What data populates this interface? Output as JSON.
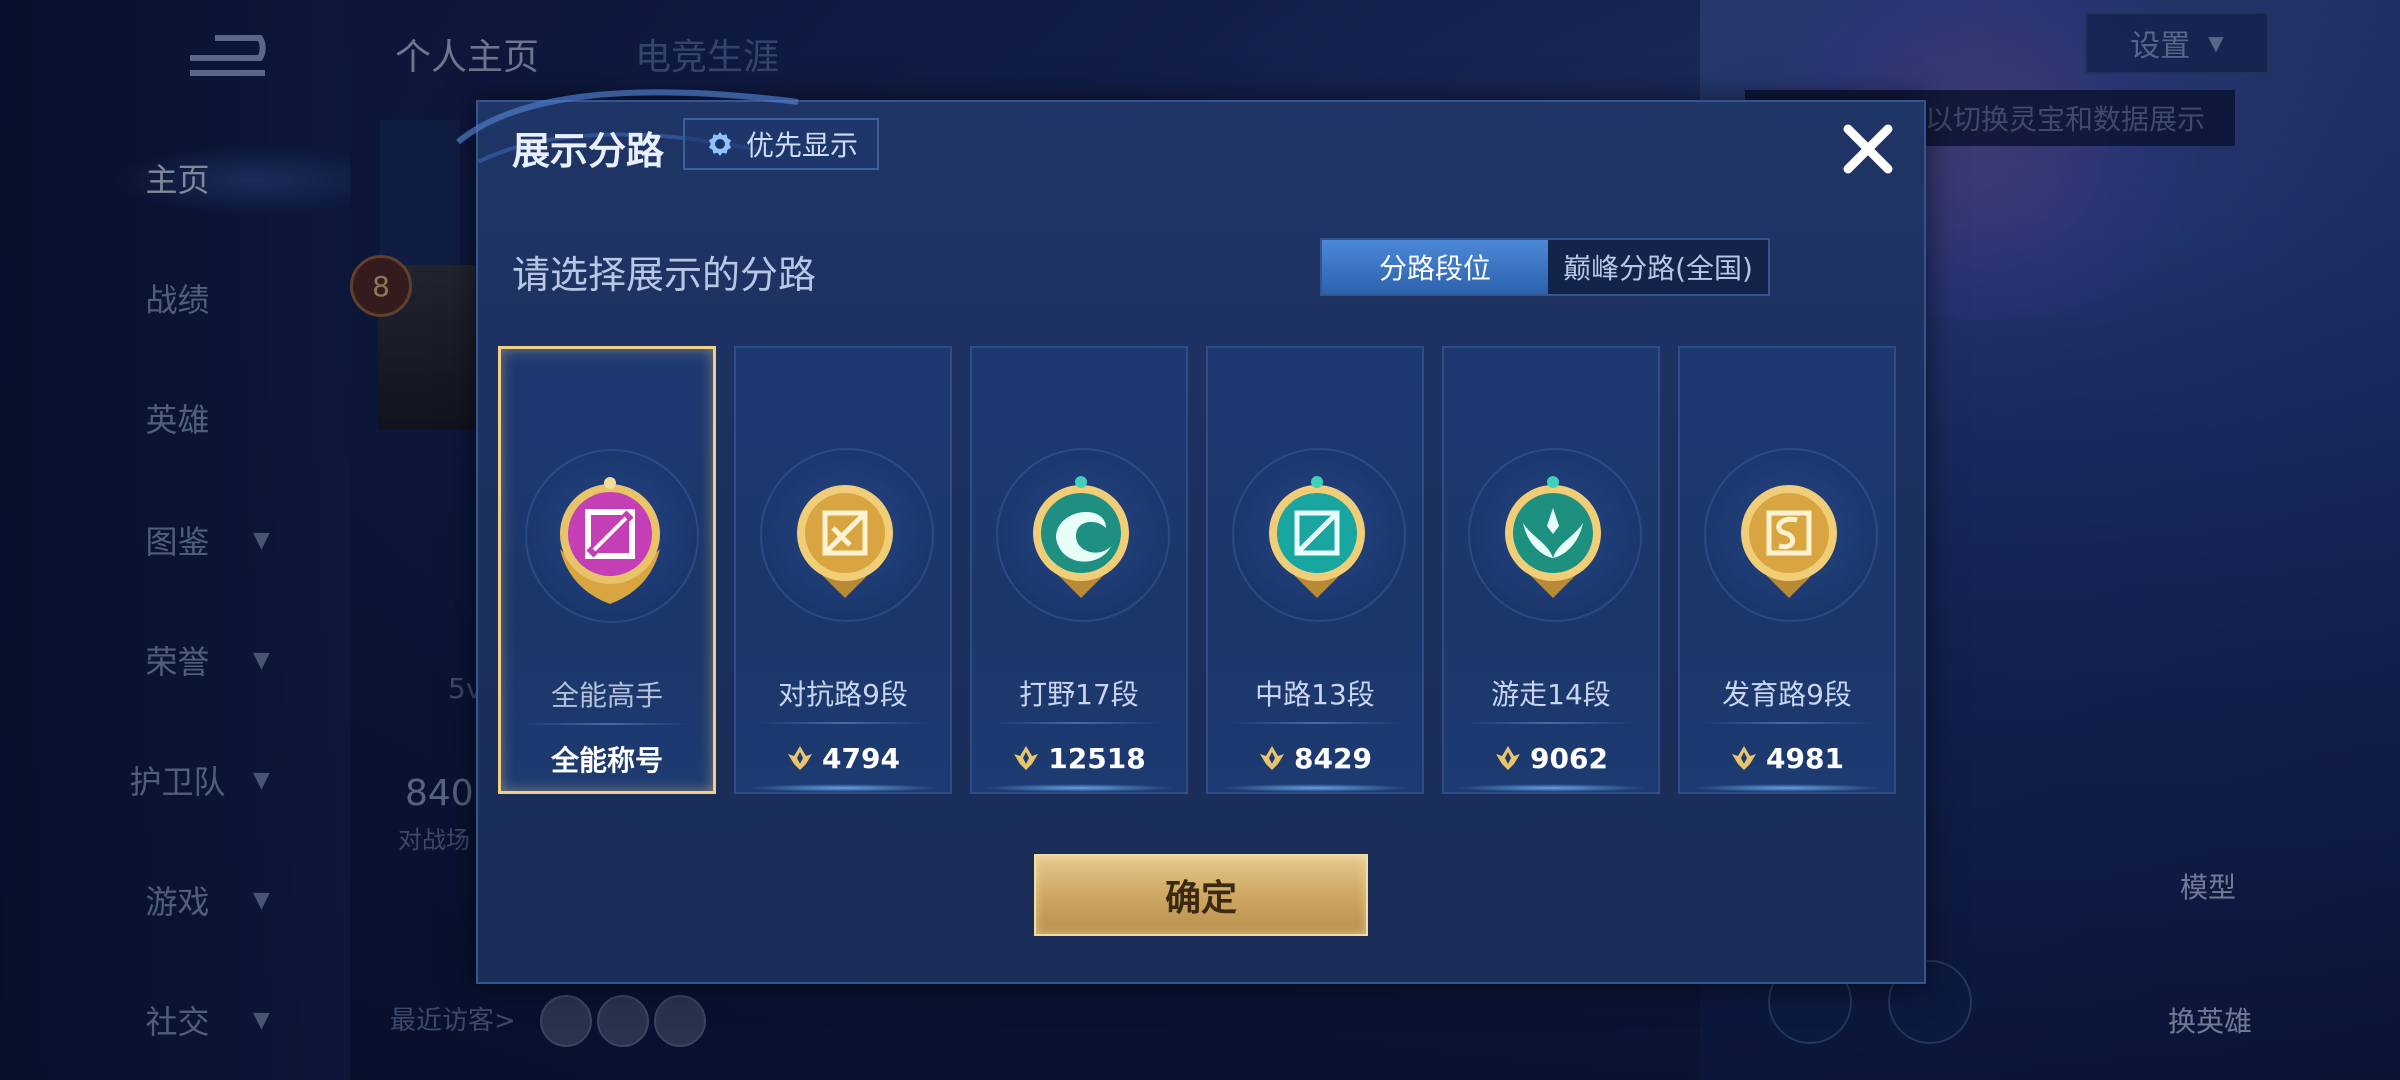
{
  "background": {
    "tabs": [
      "个人主页",
      "电竞生涯"
    ],
    "nav": [
      {
        "label": "主页",
        "has_chevron": false
      },
      {
        "label": "战绩",
        "has_chevron": false
      },
      {
        "label": "英雄",
        "has_chevron": false
      },
      {
        "label": "图鉴",
        "has_chevron": true
      },
      {
        "label": "荣誉",
        "has_chevron": true
      },
      {
        "label": "护卫队",
        "has_chevron": true
      },
      {
        "label": "游戏",
        "has_chevron": true
      },
      {
        "label": "社交",
        "has_chevron": true
      }
    ],
    "settings_label": "设置",
    "tip_text": "以切换灵宝和数据展示",
    "level": "8",
    "stat_value": "840",
    "stat_label": "对战场",
    "sv_text": "5v",
    "recent_visitors": "最近访客>",
    "side_labels": [
      "模型",
      "换英雄"
    ]
  },
  "dialog": {
    "title": "展示分路",
    "priority_label": "优先显示",
    "subtitle": "请选择展示的分路",
    "segments": [
      "分路段位",
      "巅峰分路(全国)"
    ],
    "active_segment": 0,
    "confirm_label": "确定"
  },
  "lanes": [
    {
      "rank": "全能高手",
      "value": "全能称号",
      "emblem": "all-round-emblem",
      "color": "#c43fb5",
      "selected": true,
      "show_points_icon": false
    },
    {
      "rank": "对抗路9段",
      "value": "4794",
      "emblem": "clash-lane-emblem",
      "color": "#d9a540",
      "selected": false,
      "show_points_icon": true
    },
    {
      "rank": "打野17段",
      "value": "12518",
      "emblem": "jungle-emblem",
      "color": "#1f8f82",
      "selected": false,
      "show_points_icon": true
    },
    {
      "rank": "中路13段",
      "value": "8429",
      "emblem": "mid-lane-emblem",
      "color": "#1aa6a0",
      "selected": false,
      "show_points_icon": true
    },
    {
      "rank": "游走14段",
      "value": "9062",
      "emblem": "roam-emblem",
      "color": "#1e9080",
      "selected": false,
      "show_points_icon": true
    },
    {
      "rank": "发育路9段",
      "value": "4981",
      "emblem": "farm-lane-emblem",
      "color": "#d9a540",
      "selected": false,
      "show_points_icon": true
    }
  ]
}
